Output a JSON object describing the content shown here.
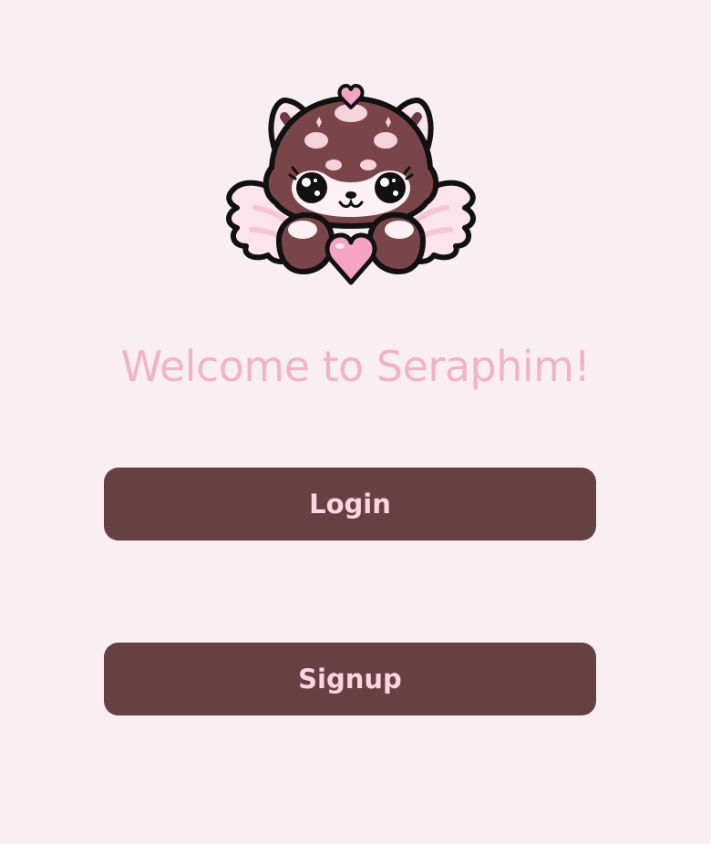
{
  "app": {
    "welcome_text": "Welcome to Seraphim!",
    "logo_icon": "red-panda-angel-mascot-icon"
  },
  "actions": {
    "login_label": "Login",
    "signup_label": "Signup"
  },
  "colors": {
    "background": "#f9eff3",
    "welcome_text": "#f0b3c8",
    "button_background": "#664141",
    "button_text": "#fcd4e2",
    "mascot_fur_dark": "#6b3c3f",
    "mascot_fur_light": "#a56e73",
    "mascot_wing": "#fbe4ec",
    "mascot_heart": "#f4a3c1"
  }
}
